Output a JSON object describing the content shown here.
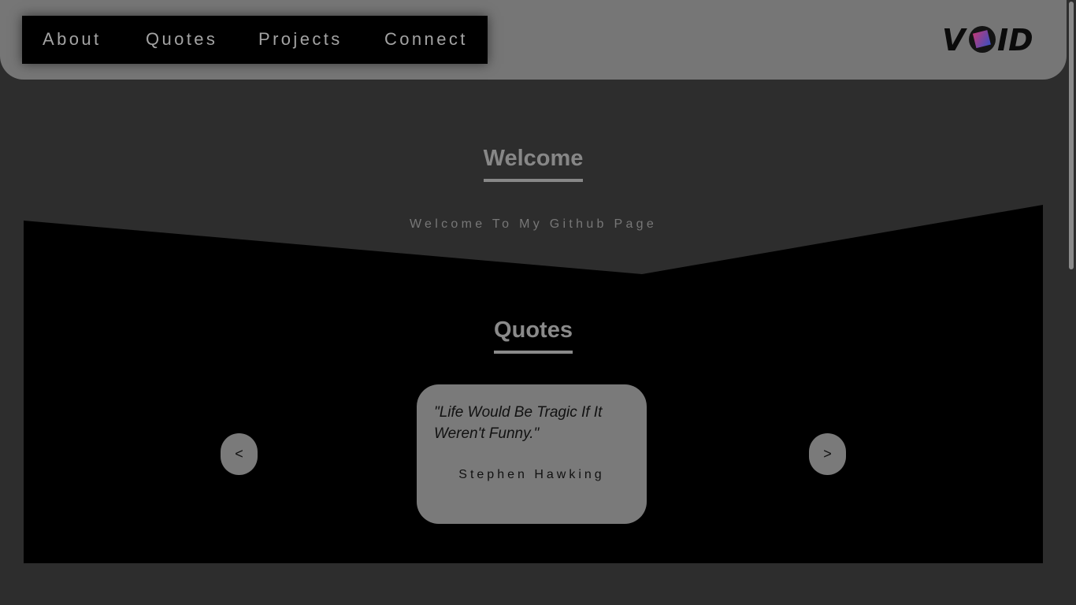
{
  "nav": {
    "items": [
      {
        "label": "About"
      },
      {
        "label": "Quotes"
      },
      {
        "label": "Projects"
      },
      {
        "label": "Connect"
      }
    ]
  },
  "logo": {
    "text": "VOID",
    "icon": "cube-o-icon"
  },
  "welcome": {
    "title": "Welcome",
    "subtitle": "Welcome To My Github Page"
  },
  "quotes": {
    "title": "Quotes",
    "current": {
      "text": "\"Life Would Be Tragic If It Weren't Funny.\"",
      "author": "Stephen Hawking"
    },
    "prev_label": "<",
    "next_label": ">"
  },
  "colors": {
    "header_bg": "#767676",
    "page_bg": "#2d2d2d",
    "nav_bg": "#000000",
    "card_bg": "#7a7a7a"
  }
}
